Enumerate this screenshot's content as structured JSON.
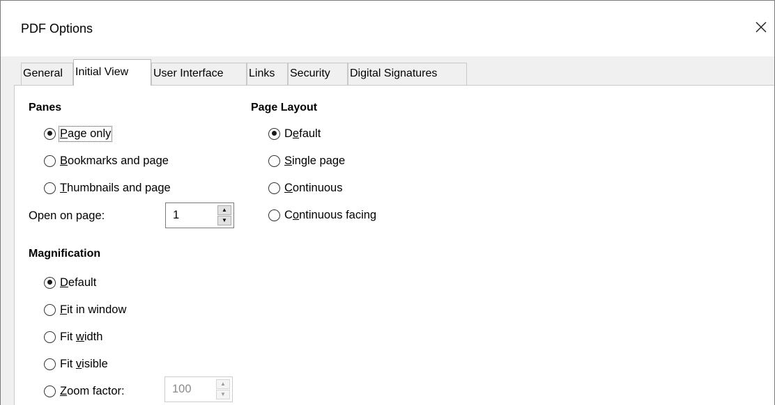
{
  "window": {
    "title": "PDF Options"
  },
  "tabs": [
    {
      "label": "General"
    },
    {
      "label": "Initial View"
    },
    {
      "label": "User Interface"
    },
    {
      "label": "Links"
    },
    {
      "label": "Security"
    },
    {
      "label": "Digital Signatures"
    }
  ],
  "active_tab": "Initial View",
  "panes": {
    "title": "Panes",
    "options": [
      {
        "pre": "",
        "mn": "P",
        "post": "age only",
        "checked": true
      },
      {
        "pre": "",
        "mn": "B",
        "post": "ookmarks and page",
        "checked": false
      },
      {
        "pre": "",
        "mn": "T",
        "post": "humbnails and page",
        "checked": false
      }
    ],
    "open_on_page": {
      "pre": "Open on pa",
      "mn": "g",
      "post": "e:",
      "value": "1"
    }
  },
  "magnification": {
    "title": "Magnification",
    "options": [
      {
        "pre": "",
        "mn": "D",
        "post": "efault",
        "checked": true
      },
      {
        "pre": "",
        "mn": "F",
        "post": "it in window",
        "checked": false
      },
      {
        "pre": "Fit ",
        "mn": "w",
        "post": "idth",
        "checked": false
      },
      {
        "pre": "Fit ",
        "mn": "v",
        "post": "isible",
        "checked": false
      },
      {
        "pre": "",
        "mn": "Z",
        "post": "oom factor:",
        "checked": false
      }
    ],
    "zoom_factor": "100"
  },
  "page_layout": {
    "title": "Page Layout",
    "options": [
      {
        "pre": "D",
        "mn": "e",
        "post": "fault",
        "checked": true
      },
      {
        "pre": "",
        "mn": "S",
        "post": "ingle page",
        "checked": false
      },
      {
        "pre": "",
        "mn": "C",
        "post": "ontinuous",
        "checked": false
      },
      {
        "pre": "C",
        "mn": "o",
        "post": "ntinuous facing",
        "checked": false
      }
    ]
  },
  "icons": {
    "close": "close-icon",
    "spin_up": "spin-up-icon",
    "spin_down": "spin-down-icon"
  }
}
